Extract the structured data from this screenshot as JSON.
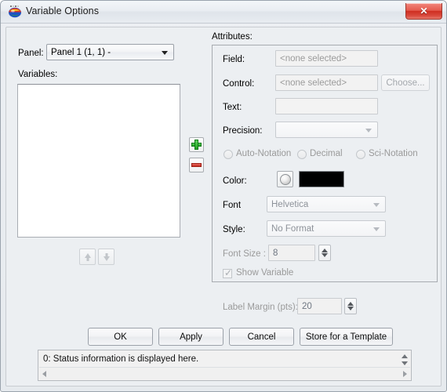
{
  "window": {
    "title": "Variable Options",
    "icon": "app-globe-icon",
    "close_label": "✕"
  },
  "left": {
    "panel_label": "Panel:",
    "panel_value": "Panel 1 (1, 1)  -",
    "variables_label": "Variables:",
    "variables_items": [],
    "add_icon": "plus-icon",
    "remove_icon": "minus-icon",
    "move_up_icon": "arrow-up-icon",
    "move_down_icon": "arrow-down-icon"
  },
  "attributes": {
    "group_label": "Attributes:",
    "field_label": "Field:",
    "field_value": "<none selected>",
    "control_label": "Control:",
    "control_value": "<none selected>",
    "choose_label": "Choose...",
    "text_label": "Text:",
    "text_value": "",
    "precision_label": "Precision:",
    "precision_value": "",
    "notation": [
      {
        "label": "Auto-Notation",
        "selected": false
      },
      {
        "label": "Decimal",
        "selected": false
      },
      {
        "label": "Sci-Notation",
        "selected": false
      }
    ],
    "color_label": "Color:",
    "color_value": "#000000",
    "font_label": "Font",
    "font_value": "Helvetica",
    "style_label": "Style:",
    "style_value": "No Format",
    "font_size_label": "Font Size :",
    "font_size_value": "8",
    "show_variable_label": "Show Variable",
    "show_variable_checked": true
  },
  "label_margin": {
    "label": "Label Margin (pts):",
    "value": "20"
  },
  "buttons": {
    "ok": "OK",
    "apply": "Apply",
    "cancel": "Cancel",
    "store": "Store for a Template"
  },
  "status": {
    "text": "0: Status information is displayed here."
  }
}
